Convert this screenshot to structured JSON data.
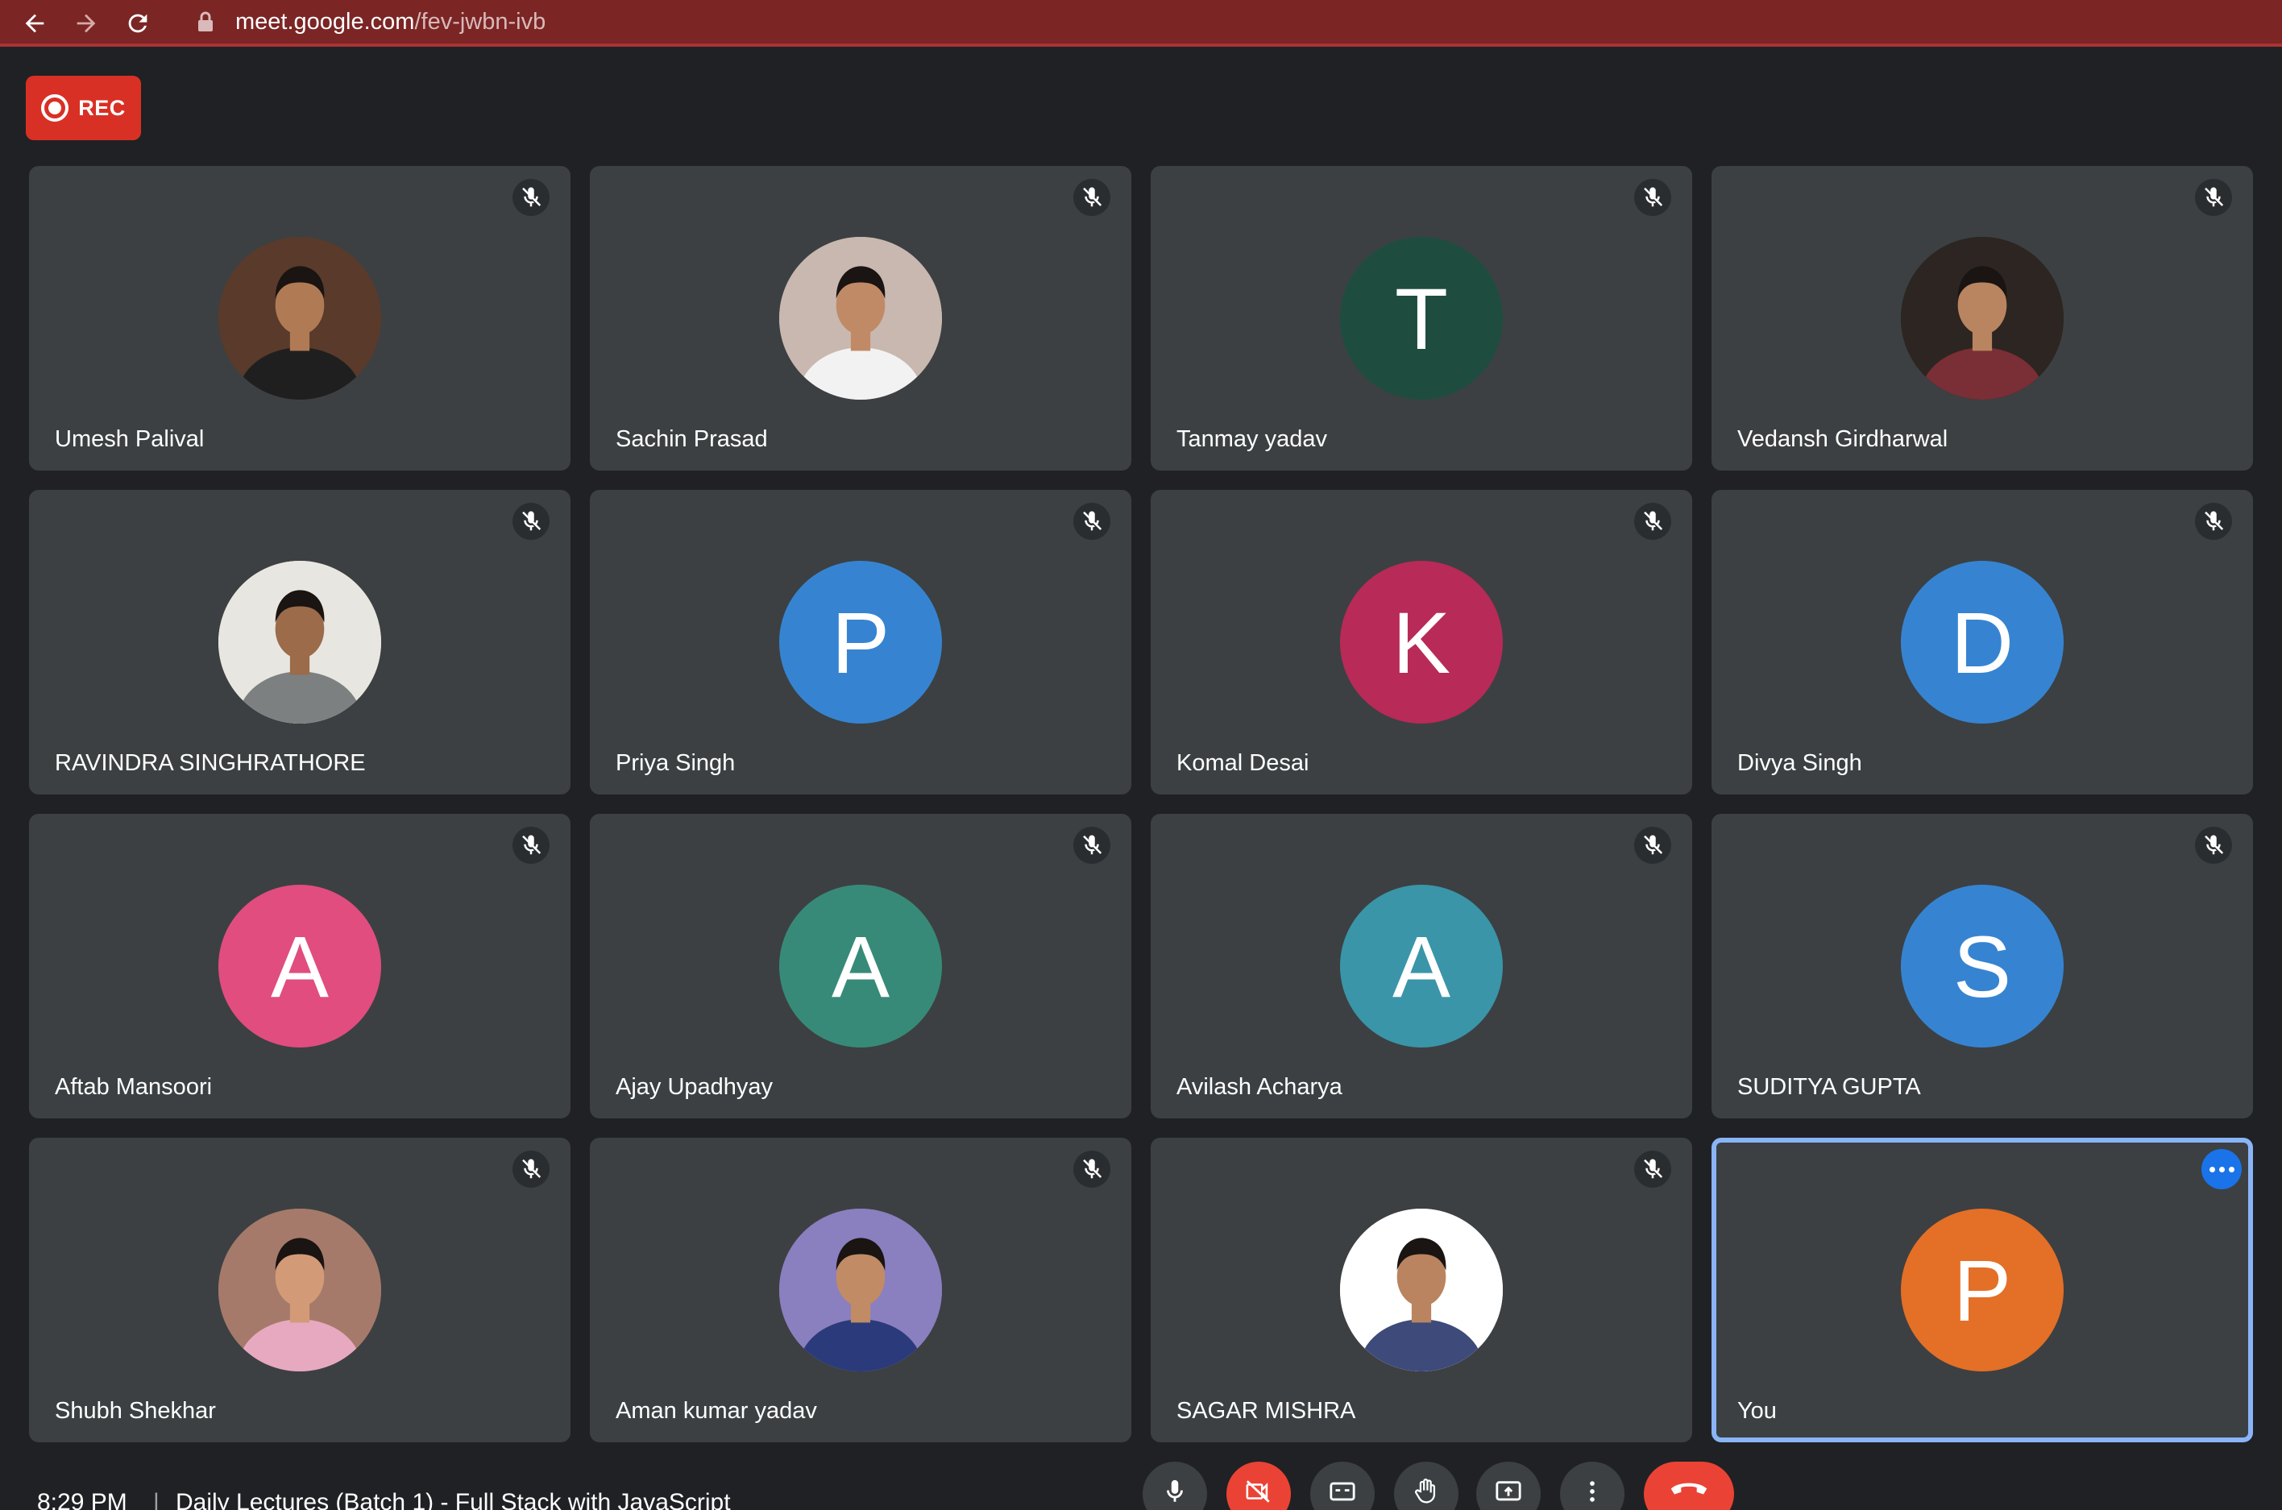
{
  "browser": {
    "url_host": "meet.google.com",
    "url_path": "/fev-jwbn-ivb"
  },
  "recording": {
    "label": "REC"
  },
  "participants": [
    {
      "name": "Umesh Palival",
      "avatar_type": "photo",
      "muted": true
    },
    {
      "name": "Sachin Prasad",
      "avatar_type": "photo",
      "muted": true
    },
    {
      "name": "Tanmay yadav",
      "avatar_type": "letter",
      "letter": "T",
      "color": "#1e4d3f",
      "muted": true
    },
    {
      "name": "Vedansh Girdharwal",
      "avatar_type": "photo",
      "muted": true
    },
    {
      "name": "RAVINDRA SINGHRATHORE",
      "avatar_type": "photo",
      "muted": true
    },
    {
      "name": "Priya Singh",
      "avatar_type": "letter",
      "letter": "P",
      "color": "#3684d1",
      "muted": true
    },
    {
      "name": "Komal Desai",
      "avatar_type": "letter",
      "letter": "K",
      "color": "#b82a57",
      "muted": true
    },
    {
      "name": "Divya Singh",
      "avatar_type": "letter",
      "letter": "D",
      "color": "#3684d1",
      "muted": true
    },
    {
      "name": "Aftab Mansoori",
      "avatar_type": "letter",
      "letter": "A",
      "color": "#e04d7e",
      "muted": true
    },
    {
      "name": "Ajay Upadhyay",
      "avatar_type": "letter",
      "letter": "A",
      "color": "#388a78",
      "muted": true
    },
    {
      "name": "Avilash Acharya",
      "avatar_type": "letter",
      "letter": "A",
      "color": "#3a95a8",
      "muted": true
    },
    {
      "name": "SUDITYA GUPTA",
      "avatar_type": "letter",
      "letter": "S",
      "color": "#3684d1",
      "muted": true
    },
    {
      "name": "Shubh Shekhar",
      "avatar_type": "photo",
      "muted": true
    },
    {
      "name": "Aman kumar yadav",
      "avatar_type": "photo",
      "muted": true
    },
    {
      "name": "SAGAR MISHRA",
      "avatar_type": "photo",
      "muted": true
    },
    {
      "name": "You",
      "avatar_type": "letter",
      "letter": "P",
      "color": "#e46f26",
      "muted": false,
      "self": true
    }
  ],
  "footer": {
    "time": "8:29 PM",
    "separator": "|",
    "meeting_title": "Daily Lectures (Batch 1) - Full Stack with JavaScript"
  },
  "colors": {
    "background": "#202124",
    "tile": "#3c4043",
    "accent": "#8ab4f8",
    "danger": "#ea4335",
    "browser_bar": "#7b2525"
  }
}
